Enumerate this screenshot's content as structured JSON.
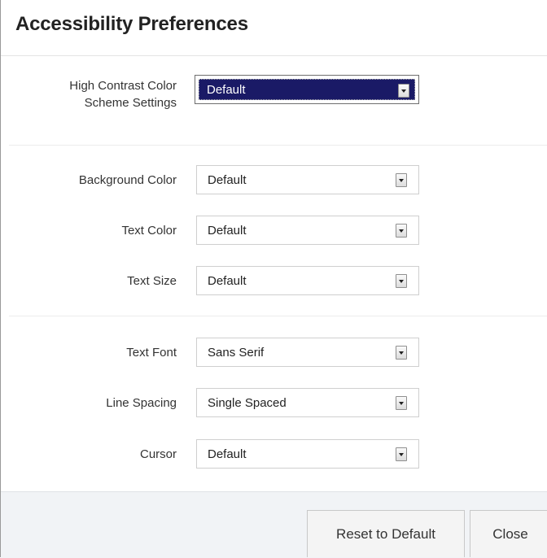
{
  "dialog": {
    "title": "Accessibility Preferences"
  },
  "high_contrast": {
    "label_line1": "High Contrast Color",
    "label_line2": "Scheme Settings",
    "value": "Default"
  },
  "color_settings": [
    {
      "label": "Background Color",
      "value": "Default"
    },
    {
      "label": "Text Color",
      "value": "Default"
    },
    {
      "label": "Text Size",
      "value": "Default"
    }
  ],
  "text_settings": [
    {
      "label": "Text Font",
      "value": "Sans Serif"
    },
    {
      "label": "Line Spacing",
      "value": "Single Spaced"
    },
    {
      "label": "Cursor",
      "value": "Default"
    }
  ],
  "footer": {
    "reset_label": "Reset to Default",
    "close_label": "Close"
  },
  "colors": {
    "highlight_select_bg": "#1a1a66",
    "footer_bg": "#f1f3f6"
  },
  "icons": {
    "dropdown": "chevron-down-icon"
  }
}
